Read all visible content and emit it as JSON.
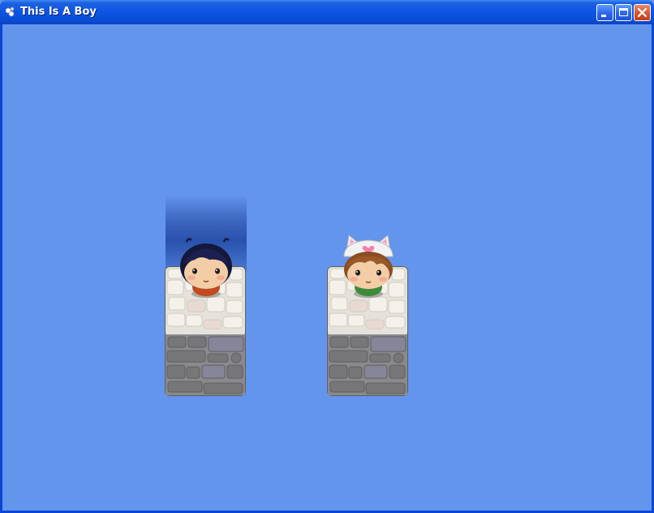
{
  "window": {
    "title": "This Is A Boy",
    "icons": {
      "app": "app-icon",
      "minimize": "minimize-icon",
      "maximize": "maximize-icon",
      "close": "close-icon"
    }
  },
  "game": {
    "background_color": "#6495ED",
    "tiles": [
      {
        "name": "stone-block",
        "highlighted": true
      },
      {
        "name": "stone-block",
        "highlighted": false
      }
    ],
    "characters": [
      {
        "name": "boy",
        "selected": true
      },
      {
        "name": "cat-girl",
        "selected": false
      }
    ]
  }
}
